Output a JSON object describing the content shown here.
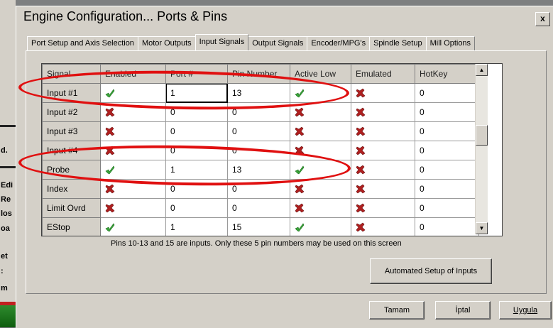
{
  "window": {
    "title": "Engine Configuration... Ports & Pins",
    "close_glyph": "x"
  },
  "tabs": [
    {
      "label": "Port Setup and Axis Selection",
      "active": false
    },
    {
      "label": "Motor Outputs",
      "active": false
    },
    {
      "label": "Input Signals",
      "active": true
    },
    {
      "label": "Output Signals",
      "active": false
    },
    {
      "label": "Encoder/MPG's",
      "active": false
    },
    {
      "label": "Spindle Setup",
      "active": false
    },
    {
      "label": "Mill Options",
      "active": false
    }
  ],
  "grid": {
    "columns": [
      "Signal",
      "Enabled",
      "Port #",
      "Pin Number",
      "Active Low",
      "Emulated",
      "HotKey"
    ],
    "rows": [
      {
        "signal": "Input #1",
        "enabled": "check",
        "port": "1",
        "pin": "13",
        "active_low": "check",
        "emulated": "cross",
        "hotkey": "0"
      },
      {
        "signal": "Input #2",
        "enabled": "cross",
        "port": "0",
        "pin": "0",
        "active_low": "cross",
        "emulated": "cross",
        "hotkey": "0"
      },
      {
        "signal": "Input #3",
        "enabled": "cross",
        "port": "0",
        "pin": "0",
        "active_low": "cross",
        "emulated": "cross",
        "hotkey": "0"
      },
      {
        "signal": "Input #4",
        "enabled": "cross",
        "port": "0",
        "pin": "0",
        "active_low": "cross",
        "emulated": "cross",
        "hotkey": "0"
      },
      {
        "signal": "Probe",
        "enabled": "check",
        "port": "1",
        "pin": "13",
        "active_low": "check",
        "emulated": "cross",
        "hotkey": "0"
      },
      {
        "signal": "Index",
        "enabled": "cross",
        "port": "0",
        "pin": "0",
        "active_low": "cross",
        "emulated": "cross",
        "hotkey": "0"
      },
      {
        "signal": "Limit Ovrd",
        "enabled": "cross",
        "port": "0",
        "pin": "0",
        "active_low": "cross",
        "emulated": "cross",
        "hotkey": "0"
      },
      {
        "signal": "EStop",
        "enabled": "check",
        "port": "1",
        "pin": "15",
        "active_low": "check",
        "emulated": "cross",
        "hotkey": "0"
      }
    ]
  },
  "scrollbar": {
    "up_glyph": "▲",
    "down_glyph": "▼"
  },
  "info_text": "Pins 10-13 and 15 are inputs. Only these 5 pin numbers may be used on this screen",
  "buttons": {
    "automated_setup": "Automated Setup of Inputs",
    "ok": "Tamam",
    "cancel": "İptal",
    "apply": "Uygula"
  },
  "background_app": {
    "fragments": [
      "d.",
      "Edi",
      "Re",
      "los",
      "oa",
      "et",
      ":",
      "m"
    ]
  },
  "colors": {
    "check": "#3aa53a",
    "cross": "#b02020",
    "annotation": "#e01010",
    "dialog": "#d4d0c8"
  }
}
